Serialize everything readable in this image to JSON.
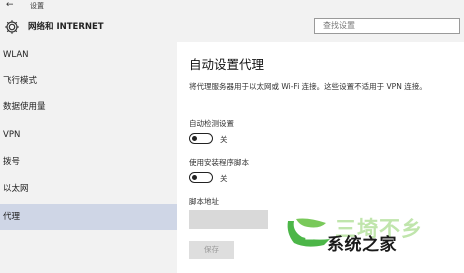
{
  "window": {
    "title": "设置",
    "back_icon": "arrow-left-icon"
  },
  "header": {
    "section_title": "网络和 INTERNET",
    "icon": "gear-icon",
    "search_placeholder": "查找设置"
  },
  "sidebar": {
    "items": [
      {
        "label": "WLAN",
        "active": false
      },
      {
        "label": "飞行模式",
        "active": false
      },
      {
        "label": "数据使用量",
        "active": false
      },
      {
        "label": "VPN",
        "active": false
      },
      {
        "label": "拨号",
        "active": false
      },
      {
        "label": "以太网",
        "active": false
      },
      {
        "label": "代理",
        "active": true
      }
    ]
  },
  "main": {
    "title": "自动设置代理",
    "description": "将代理服务器用于以太网或 Wi-Fi 连接。这些设置不适用于 VPN 连接。",
    "auto_detect": {
      "label": "自动检测设置",
      "state": "关"
    },
    "use_script": {
      "label": "使用安装程序脚本",
      "state": "关"
    },
    "script_address": {
      "label": "脚本地址",
      "value": ""
    },
    "save_button": "保存"
  },
  "watermark": {
    "text": "系统之家",
    "faded_text": "三埼不乡"
  },
  "colors": {
    "sidebar_bg": "#f2f2f2",
    "active_item_bg": "#cfd6e6",
    "watermark_green": "#4cb648"
  }
}
